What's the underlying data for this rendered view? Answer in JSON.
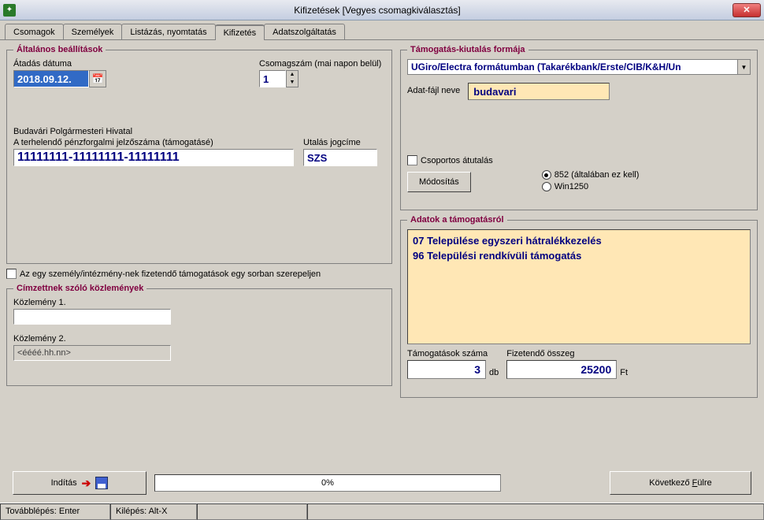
{
  "window": {
    "title": "Kifizetések   [Vegyes csomagkiválasztás]"
  },
  "tabs": {
    "t0": "Csomagok",
    "t1": "Személyek",
    "t2": "Listázás, nyomtatás",
    "t3": "Kifizetés",
    "t4": "Adatszolgáltatás"
  },
  "general": {
    "legend": "Általános beállítások",
    "date_label": "Átadás dátuma",
    "date_value": "2018.09.12.",
    "pkgnum_label": "Csomagszám (mai napon belül)",
    "pkgnum_value": "1",
    "office": "Budavári Polgármesteri Hivatal",
    "account_label": "A terhelendő pénzforgalmi jelzőszáma (támogatásé)",
    "account_value": "11111111-11111111-11111111",
    "transfer_title_label": "Utalás jogcíme",
    "transfer_title_value": "SZS",
    "one_row_label": "Az egy személy/intézmény-nek fizetendő támogatások egy sorban szerepeljen"
  },
  "messages": {
    "legend": "Címzettnek szóló közlemények",
    "m1_label": "Közlemény 1.",
    "m1_value": "",
    "m2_label": "Közlemény 2.",
    "m2_value": "<éééé.hh.nn>"
  },
  "payout": {
    "legend": "Támogatás-kiutalás formája",
    "format": "UGiro/Electra formátumban (Takarékbank/Erste/CIB/K&H/Un",
    "file_label": "Adat-fájl neve",
    "file_value": "budavari",
    "group_transfer": "Csoportos átutalás",
    "modify": "Módosítás",
    "enc852": "852 (általában ez kell)",
    "enc1250": "Win1250"
  },
  "support": {
    "legend": "Adatok a támogatásról",
    "items": {
      "0": "07 Települése egyszeri hátralékkezelés",
      "1": "96 Települési rendkívüli támogatás"
    },
    "count_label": "Támogatások száma",
    "count_value": "3",
    "count_unit": "db",
    "amount_label": "Fizetendő összeg",
    "amount_value": "25200",
    "amount_unit": "Ft"
  },
  "bottom": {
    "start": "Indítás",
    "progress": "0%",
    "next_prefix": "Következő ",
    "next_accel": "F",
    "next_suffix": "ülre"
  },
  "status": {
    "s0": "Továbblépés: Enter",
    "s1": "Kilépés: Alt-X"
  }
}
